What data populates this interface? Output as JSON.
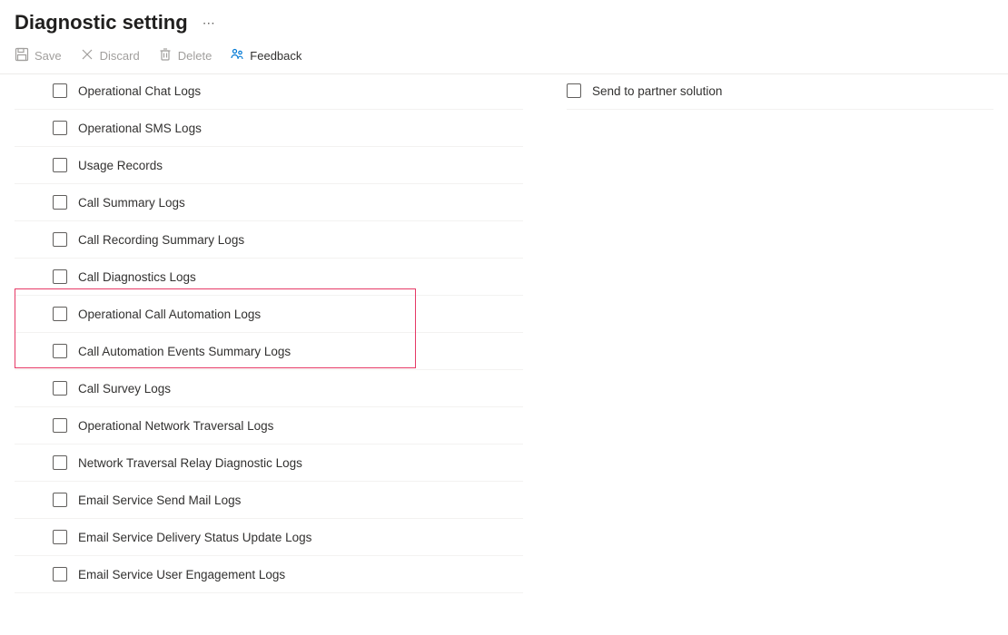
{
  "page": {
    "title": "Diagnostic setting"
  },
  "toolbar": {
    "save": {
      "label": "Save"
    },
    "discard": {
      "label": "Discard"
    },
    "delete": {
      "label": "Delete"
    },
    "feedback": {
      "label": "Feedback"
    }
  },
  "logs": {
    "items": [
      {
        "label": "Operational Chat Logs"
      },
      {
        "label": "Operational SMS Logs"
      },
      {
        "label": "Usage Records"
      },
      {
        "label": "Call Summary Logs"
      },
      {
        "label": "Call Recording Summary Logs"
      },
      {
        "label": "Call Diagnostics Logs"
      },
      {
        "label": "Operational Call Automation Logs"
      },
      {
        "label": "Call Automation Events Summary Logs"
      },
      {
        "label": "Call Survey Logs"
      },
      {
        "label": "Operational Network Traversal Logs"
      },
      {
        "label": "Network Traversal Relay Diagnostic Logs"
      },
      {
        "label": "Email Service Send Mail Logs"
      },
      {
        "label": "Email Service Delivery Status Update Logs"
      },
      {
        "label": "Email Service User Engagement Logs"
      }
    ]
  },
  "destination": {
    "partner_label": "Send to partner solution"
  }
}
